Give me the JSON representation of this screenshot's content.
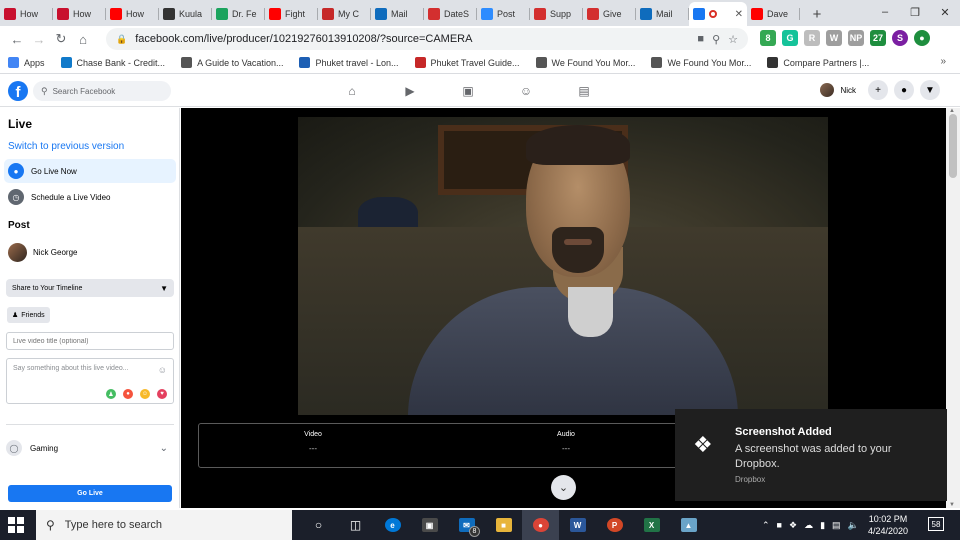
{
  "browser": {
    "tabs": [
      {
        "label": "How",
        "color": "#c8102e"
      },
      {
        "label": "How",
        "color": "#c8102e"
      },
      {
        "label": "How",
        "color": "#ff0000"
      },
      {
        "label": "Kuula",
        "color": "#333333"
      },
      {
        "label": "Dr. Fe",
        "color": "#1ba35e"
      },
      {
        "label": "Fight",
        "color": "#ff0000"
      },
      {
        "label": "My C",
        "color": "#c62828"
      },
      {
        "label": "Mail",
        "color": "#0f6cbd"
      },
      {
        "label": "DateS",
        "color": "#d32f2f"
      },
      {
        "label": "Post",
        "color": "#2d8cff"
      },
      {
        "label": "Supp",
        "color": "#d32f2f"
      },
      {
        "label": "Give",
        "color": "#d32f2f"
      },
      {
        "label": "Mail",
        "color": "#0f6cbd"
      },
      {
        "label": "",
        "color": "#1877f2"
      },
      {
        "label": "Dave",
        "color": "#ff0000"
      }
    ],
    "active_tab_index": 13,
    "url": "facebook.com/live/producer/10219276013910208/?source=CAMERA",
    "profile_initial": "S",
    "extensions": [
      {
        "label": "8",
        "color": "#34a853"
      },
      {
        "label": "G",
        "color": "#15c39a"
      },
      {
        "label": "R",
        "color": "#bdbdbd"
      },
      {
        "label": "W",
        "color": "#9e9e9e"
      },
      {
        "label": "NP",
        "color": "#9e9e9e"
      },
      {
        "label": "27",
        "color": "#1e8e3e"
      }
    ]
  },
  "bookmarks": [
    {
      "label": "Apps",
      "icon": "apps-grid-icon",
      "color": "#4285f4"
    },
    {
      "label": "Chase Bank - Credit...",
      "icon": "chase-icon",
      "color": "#117aca"
    },
    {
      "label": "A Guide to Vacation...",
      "icon": "th-icon",
      "color": "#555555"
    },
    {
      "label": "Phuket travel - Lon...",
      "icon": "lp-icon",
      "color": "#1d5fb4"
    },
    {
      "label": "Phuket Travel Guide...",
      "icon": "usn-icon",
      "color": "#c62828"
    },
    {
      "label": "We Found You Mor...",
      "icon": "globe-icon",
      "color": "#555555"
    },
    {
      "label": "We Found You Mor...",
      "icon": "globe-icon",
      "color": "#555555"
    },
    {
      "label": "Compare Partners |...",
      "icon": "tripadvisor-icon",
      "color": "#333333"
    }
  ],
  "fb_header": {
    "search_placeholder": "Search Facebook",
    "user_name": "Nick"
  },
  "left_panel": {
    "title": "Live",
    "switch_link": "Switch to previous version",
    "items": [
      {
        "label": "Go Live Now",
        "active": true
      },
      {
        "label": "Schedule a Live Video",
        "active": false
      }
    ],
    "post_heading": "Post",
    "poster_name": "Nick George",
    "share_select": "Share to Your Timeline",
    "audience": "Friends",
    "title_placeholder": "Live video title (optional)",
    "description_placeholder": "Say something about this live video...",
    "category": "Gaming",
    "go_live_button": "Go Live"
  },
  "stats": [
    {
      "label": "Video",
      "value": "---"
    },
    {
      "label": "Audio",
      "value": "---"
    }
  ],
  "toast": {
    "title": "Screenshot Added",
    "body": "A screenshot was added to your Dropbox.",
    "source": "Dropbox"
  },
  "taskbar": {
    "search_placeholder": "Type here to search",
    "mail_badge": "8",
    "time": "10:02 PM",
    "date": "4/24/2020",
    "notification_count": "58"
  },
  "colors": {
    "fb_blue": "#1877f2",
    "toast_bg": "#1f1f1f",
    "taskbar_bg": "#1b1f2a"
  }
}
